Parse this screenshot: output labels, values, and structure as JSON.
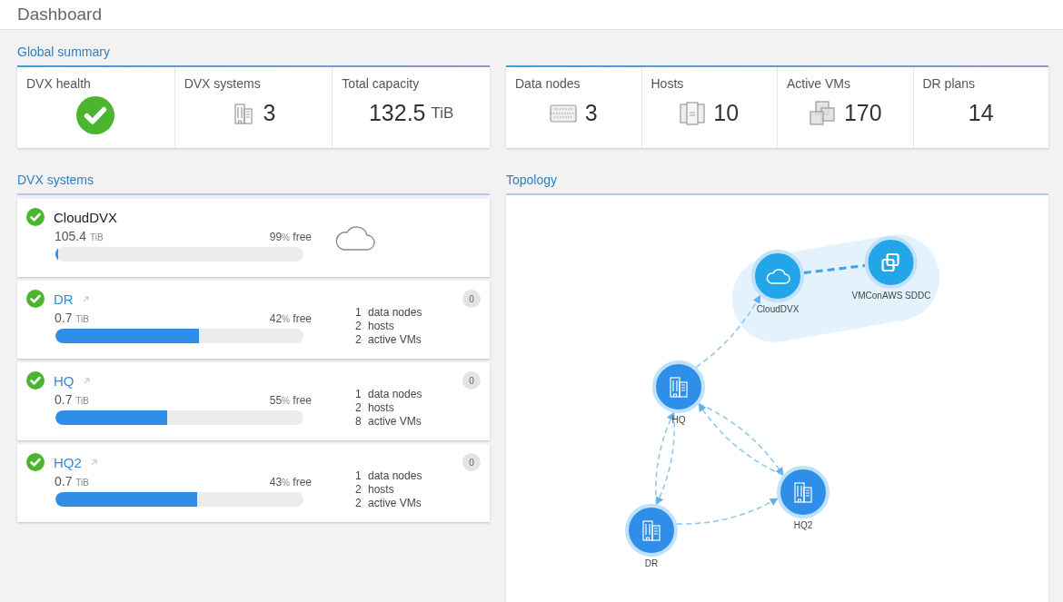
{
  "header": {
    "title": "Dashboard"
  },
  "global_summary": {
    "title": "Global summary",
    "groups": [
      [
        {
          "label": "DVX health",
          "kind": "health",
          "healthy": true
        },
        {
          "label": "DVX systems",
          "kind": "systems",
          "value": "3"
        },
        {
          "label": "Total capacity",
          "kind": "capacity",
          "value": "132.5",
          "unit": "TiB"
        }
      ],
      [
        {
          "label": "Data nodes",
          "kind": "nodes",
          "value": "3"
        },
        {
          "label": "Hosts",
          "kind": "hosts",
          "value": "10"
        },
        {
          "label": "Active VMs",
          "kind": "vms",
          "value": "170"
        },
        {
          "label": "DR plans",
          "kind": "plain",
          "value": "14"
        }
      ]
    ]
  },
  "dvx_systems": {
    "title": "DVX systems",
    "items": [
      {
        "kind": "cloud",
        "name": "CloudDVX",
        "healthy": true,
        "capacity": "105.4",
        "unit": "TiB",
        "free": "99",
        "free_unit": "%",
        "free_label": "free",
        "level": 0.01
      },
      {
        "kind": "site",
        "name": "DR",
        "healthy": true,
        "capacity": "0.7",
        "unit": "TiB",
        "free": "42",
        "free_unit": "%",
        "free_label": "free",
        "level": 0.58,
        "badge": "0",
        "stats": [
          {
            "count": "1",
            "label": "data nodes"
          },
          {
            "count": "2",
            "label": "hosts"
          },
          {
            "count": "2",
            "label": "active VMs"
          }
        ]
      },
      {
        "kind": "site",
        "name": "HQ",
        "healthy": true,
        "capacity": "0.7",
        "unit": "TiB",
        "free": "55",
        "free_unit": "%",
        "free_label": "free",
        "level": 0.45,
        "badge": "0",
        "stats": [
          {
            "count": "1",
            "label": "data nodes"
          },
          {
            "count": "2",
            "label": "hosts"
          },
          {
            "count": "8",
            "label": "active VMs"
          }
        ]
      },
      {
        "kind": "site",
        "name": "HQ2",
        "healthy": true,
        "capacity": "0.7",
        "unit": "TiB",
        "free": "43",
        "free_unit": "%",
        "free_label": "free",
        "level": 0.57,
        "badge": "0",
        "stats": [
          {
            "count": "1",
            "label": "data nodes"
          },
          {
            "count": "2",
            "label": "hosts"
          },
          {
            "count": "2",
            "label": "active VMs"
          }
        ]
      }
    ]
  },
  "topology": {
    "title": "Topology",
    "nodes": [
      {
        "name": "CloudDVX",
        "kind": "cloud"
      },
      {
        "name": "VMConAWS SDDC",
        "kind": "vmc"
      },
      {
        "name": "HQ",
        "kind": "site"
      },
      {
        "name": "HQ2",
        "kind": "site"
      },
      {
        "name": "DR",
        "kind": "site"
      }
    ]
  }
}
